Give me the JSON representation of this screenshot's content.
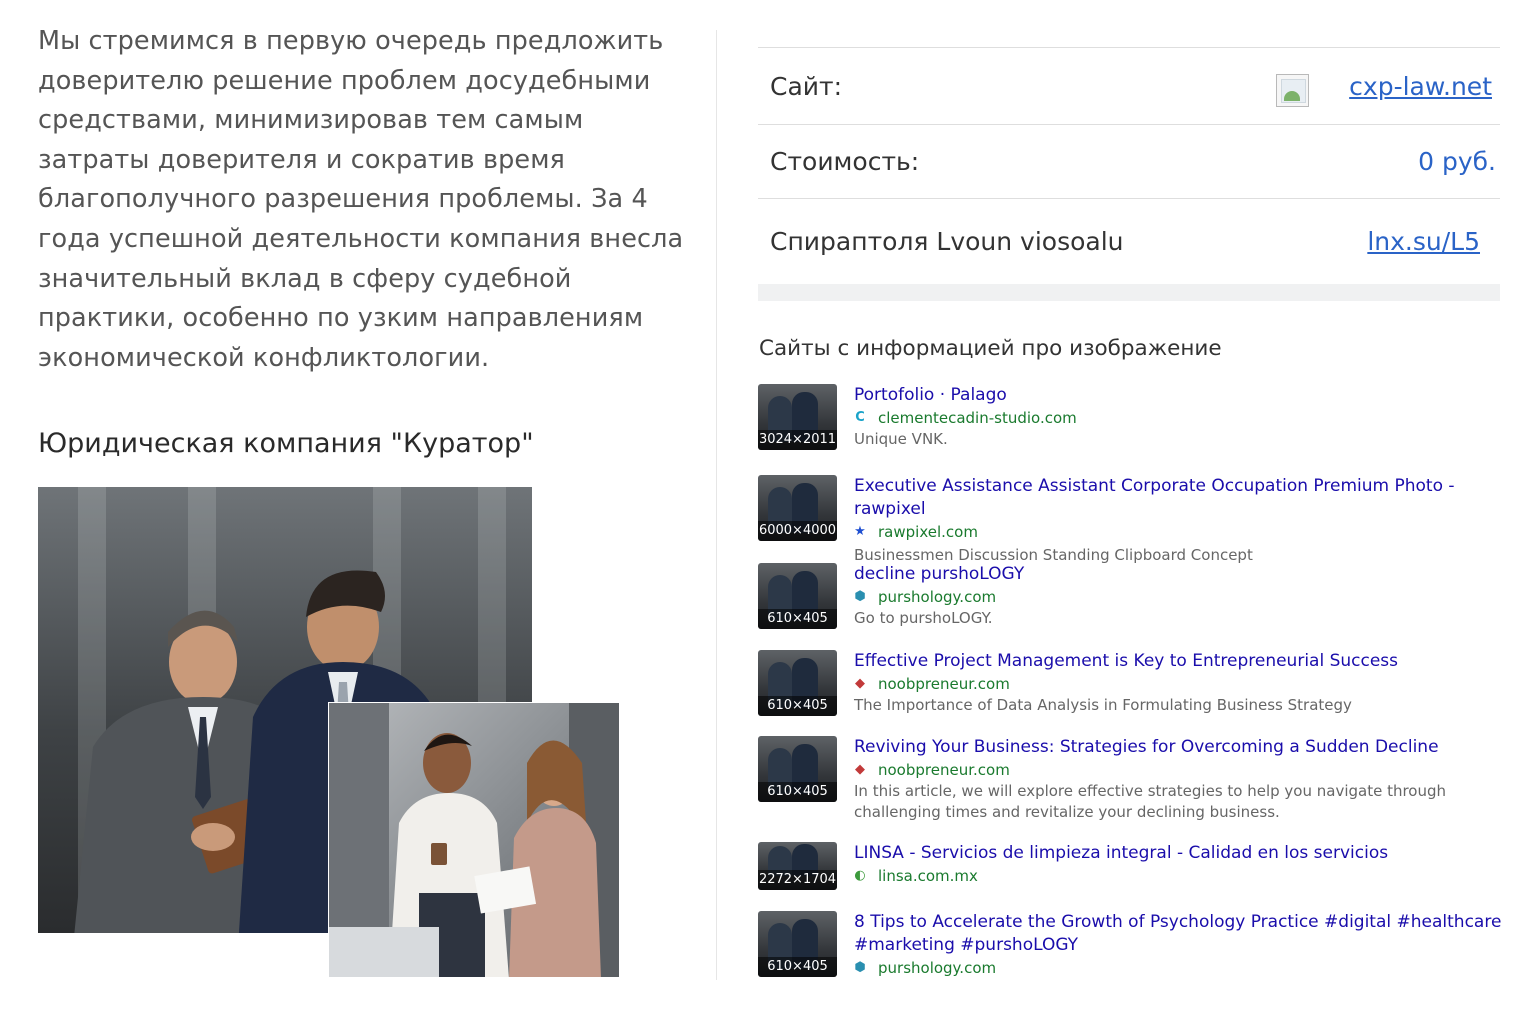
{
  "left": {
    "intro_text": "Мы стремимся в первую очередь предложить доверителю решение проблем досудебными средствами, минимизировав тем самым затраты доверителя и сократив время благополучного разрешения проблемы. За 4 года успешной деятельности компания внесла значительный вклад в сферу судебной практики, особенно по узким направлениям экономической конфликтологии.",
    "company_title": "Юридическая компания \"Куратор\""
  },
  "info": {
    "site_label": "Сайт:",
    "site_value": "cxp-law.net",
    "cost_label": "Стоимость:",
    "cost_value": "0 руб.",
    "short_label": "Спираптоля Lvoun viosoalu",
    "short_value": "lnx.su/L5"
  },
  "sites": {
    "title": "Сайты с информацией про изображение",
    "results": [
      {
        "size": "3024×2011",
        "title": "Portofolio · Palago",
        "site": "clementecadin-studio.com",
        "favicon": "C",
        "favicon_color": "#1aa3c9",
        "desc": "Unique VNK."
      },
      {
        "size": "6000×4000",
        "title": "Executive Assistance Assistant Corporate Occupation Premium Photo - rawpixel",
        "site": "rawpixel.com",
        "favicon": "★",
        "favicon_color": "#1f4fd1",
        "desc": "Businessmen Discussion Standing Clipboard Concept"
      },
      {
        "size": "610×405",
        "title": "decline pursho​LOGY",
        "site": "purshology.com",
        "favicon": "⬢",
        "favicon_color": "#2a8fb0",
        "desc": "Go to purshoLOGY."
      },
      {
        "size": "610×405",
        "title": "Effective Project Management is Key to Entrepreneurial Success",
        "site": "noobpreneur.com",
        "favicon": "◆",
        "favicon_color": "#c23a3a",
        "desc": "The Importance of Data Analysis in Formulating Business Strategy"
      },
      {
        "size": "610×405",
        "title": "Reviving Your Business: Strategies for Overcoming a Sudden Decline",
        "site": "noobpreneur.com",
        "favicon": "◆",
        "favicon_color": "#c23a3a",
        "desc": "In this article, we will explore effective strategies to help you navigate through challenging times and revitalize your declining business."
      },
      {
        "size": "2272×1704",
        "title": "LINSA - Servicios de limpieza integral - Calidad en los servicios",
        "site": "linsa.com.mx",
        "favicon": "◐",
        "favicon_color": "#3c9a3c",
        "desc": ""
      },
      {
        "size": "610×405",
        "title": "8 Tips to Accelerate the Growth of Psychology Practice #digital #healthcare #marketing #pursho​LOGY",
        "site": "purshology.com",
        "favicon": "⬢",
        "favicon_color": "#2a8fb0",
        "desc": ""
      }
    ]
  }
}
